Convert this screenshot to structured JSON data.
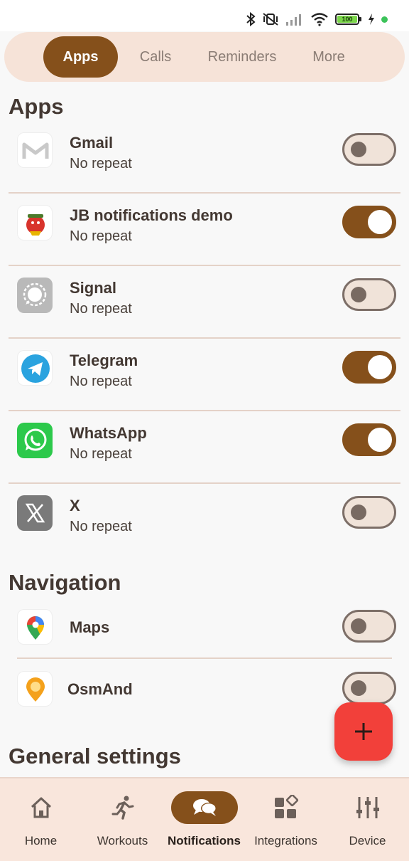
{
  "status_bar": {
    "battery_level": "100",
    "icons": [
      "bluetooth-icon",
      "vibrate-off-icon",
      "signal-icon",
      "wifi-icon",
      "battery-icon",
      "charging-icon"
    ]
  },
  "tabs": [
    {
      "label": "Apps",
      "active": true
    },
    {
      "label": "Calls",
      "active": false
    },
    {
      "label": "Reminders",
      "active": false
    },
    {
      "label": "More",
      "active": false
    }
  ],
  "sections": {
    "apps_title": "Apps",
    "navigation_title": "Navigation",
    "general_title": "General settings"
  },
  "apps": [
    {
      "name": "Gmail",
      "subtitle": "No repeat",
      "enabled": false,
      "icon": "gmail-icon"
    },
    {
      "name": "JB notifications demo",
      "subtitle": "No repeat",
      "enabled": true,
      "icon": "jb-demo-icon"
    },
    {
      "name": "Signal",
      "subtitle": "No repeat",
      "enabled": false,
      "icon": "signal-app-icon"
    },
    {
      "name": "Telegram",
      "subtitle": "No repeat",
      "enabled": true,
      "icon": "telegram-icon"
    },
    {
      "name": "WhatsApp",
      "subtitle": "No repeat",
      "enabled": true,
      "icon": "whatsapp-icon"
    },
    {
      "name": "X",
      "subtitle": "No repeat",
      "enabled": false,
      "icon": "x-icon"
    }
  ],
  "navigation_apps": [
    {
      "name": "Maps",
      "enabled": false,
      "icon": "maps-icon"
    },
    {
      "name": "OsmAnd",
      "enabled": false,
      "icon": "osmand-icon"
    }
  ],
  "fab": {
    "icon": "plus-icon"
  },
  "bottom_nav": [
    {
      "label": "Home",
      "icon": "home-icon",
      "active": false
    },
    {
      "label": "Workouts",
      "icon": "running-icon",
      "active": false
    },
    {
      "label": "Notifications",
      "icon": "chat-icon",
      "active": true
    },
    {
      "label": "Integrations",
      "icon": "widgets-icon",
      "active": false
    },
    {
      "label": "Device",
      "icon": "sliders-icon",
      "active": false
    }
  ],
  "colors": {
    "accent": "#85501b",
    "tab_bar_bg": "#f6e3d8",
    "fab": "#f2403a",
    "toggle_off_bg": "#f0e3d9"
  }
}
